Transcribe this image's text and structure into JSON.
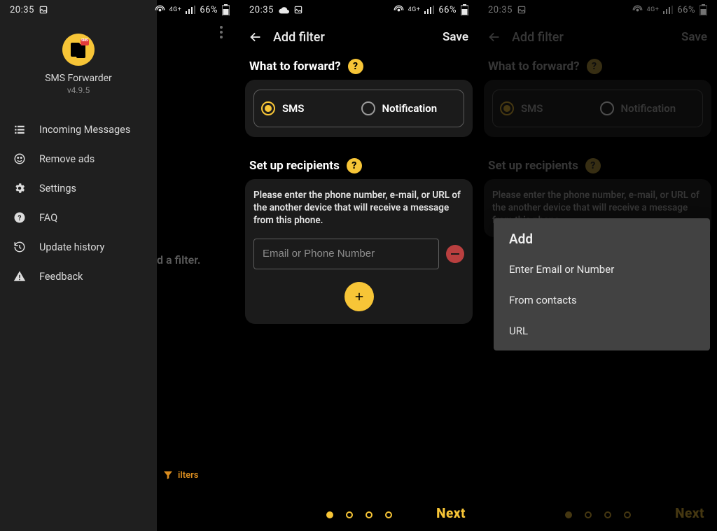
{
  "status": {
    "time": "20:35",
    "battery": "66%",
    "net": "4G+"
  },
  "drawer": {
    "app_name": "SMS Forwarder",
    "version": "v4.9.5",
    "items": [
      {
        "id": "incoming",
        "label": "Incoming Messages",
        "icon": "list-icon"
      },
      {
        "id": "remove_ads",
        "label": "Remove ads",
        "icon": "smile-icon"
      },
      {
        "id": "settings",
        "label": "Settings",
        "icon": "gear-icon"
      },
      {
        "id": "faq",
        "label": "FAQ",
        "icon": "help-icon"
      },
      {
        "id": "history",
        "label": "Update history",
        "icon": "history-icon"
      },
      {
        "id": "feedback",
        "label": "Feedback",
        "icon": "warning-icon"
      }
    ]
  },
  "behind": {
    "message": "d a filter.",
    "fab_label": "ilters"
  },
  "addfilter": {
    "title": "Add filter",
    "save": "Save",
    "section_what": "What to forward?",
    "opt_sms": "SMS",
    "opt_notif": "Notification",
    "section_recip": "Set up recipients",
    "recip_desc": "Please enter the phone number, e-mail, or URL of the another device that will receive a message from this phone.",
    "input_placeholder": "Email or Phone Number",
    "next": "Next"
  },
  "popup": {
    "title": "Add",
    "items": [
      "Enter Email or Number",
      "From contacts",
      "URL"
    ]
  }
}
